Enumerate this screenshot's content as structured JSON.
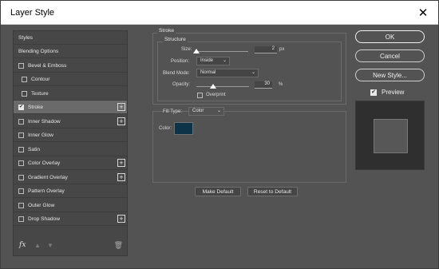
{
  "window": {
    "title": "Layer Style",
    "close_glyph": "✕"
  },
  "styles_list": {
    "header": "Styles",
    "items": [
      {
        "label": "Blending Options",
        "checkbox": false,
        "checked": false,
        "plus": false,
        "indent": 0
      },
      {
        "label": "Bevel & Emboss",
        "checkbox": true,
        "checked": false,
        "plus": false,
        "indent": 0
      },
      {
        "label": "Contour",
        "checkbox": true,
        "checked": false,
        "plus": false,
        "indent": 1
      },
      {
        "label": "Texture",
        "checkbox": true,
        "checked": false,
        "plus": false,
        "indent": 1
      },
      {
        "label": "Stroke",
        "checkbox": true,
        "checked": true,
        "plus": true,
        "indent": 0
      },
      {
        "label": "Inner Shadow",
        "checkbox": true,
        "checked": false,
        "plus": true,
        "indent": 0
      },
      {
        "label": "Inner Glow",
        "checkbox": true,
        "checked": false,
        "plus": false,
        "indent": 0
      },
      {
        "label": "Satin",
        "checkbox": true,
        "checked": false,
        "plus": false,
        "indent": 0
      },
      {
        "label": "Color Overlay",
        "checkbox": true,
        "checked": false,
        "plus": true,
        "indent": 0
      },
      {
        "label": "Gradient Overlay",
        "checkbox": true,
        "checked": false,
        "plus": true,
        "indent": 0
      },
      {
        "label": "Pattern Overlay",
        "checkbox": true,
        "checked": false,
        "plus": false,
        "indent": 0
      },
      {
        "label": "Outer Glow",
        "checkbox": true,
        "checked": false,
        "plus": false,
        "indent": 0
      },
      {
        "label": "Drop Shadow",
        "checkbox": true,
        "checked": false,
        "plus": true,
        "indent": 0
      }
    ],
    "footer": {
      "fx": "fx",
      "up": "▲",
      "down": "▼",
      "trash": "🗑"
    }
  },
  "stroke": {
    "section_title": "Stroke",
    "structure_title": "Structure",
    "size_label": "Size:",
    "size_value": "2",
    "size_unit": "px",
    "position_label": "Position:",
    "position_value": "Inside",
    "blend_label": "Blend Mode:",
    "blend_value": "Normal",
    "opacity_label": "Opacity:",
    "opacity_value": "30",
    "opacity_unit": "%",
    "overprint_label": "Overprint",
    "fill_type_label": "Fill Type:",
    "fill_type_value": "Color",
    "color_label": "Color:",
    "color_value": "#0c3348"
  },
  "actions": {
    "make_default": "Make Default",
    "reset_default": "Reset to Default"
  },
  "right": {
    "ok": "OK",
    "cancel": "Cancel",
    "new_style": "New Style...",
    "preview_label": "Preview"
  }
}
